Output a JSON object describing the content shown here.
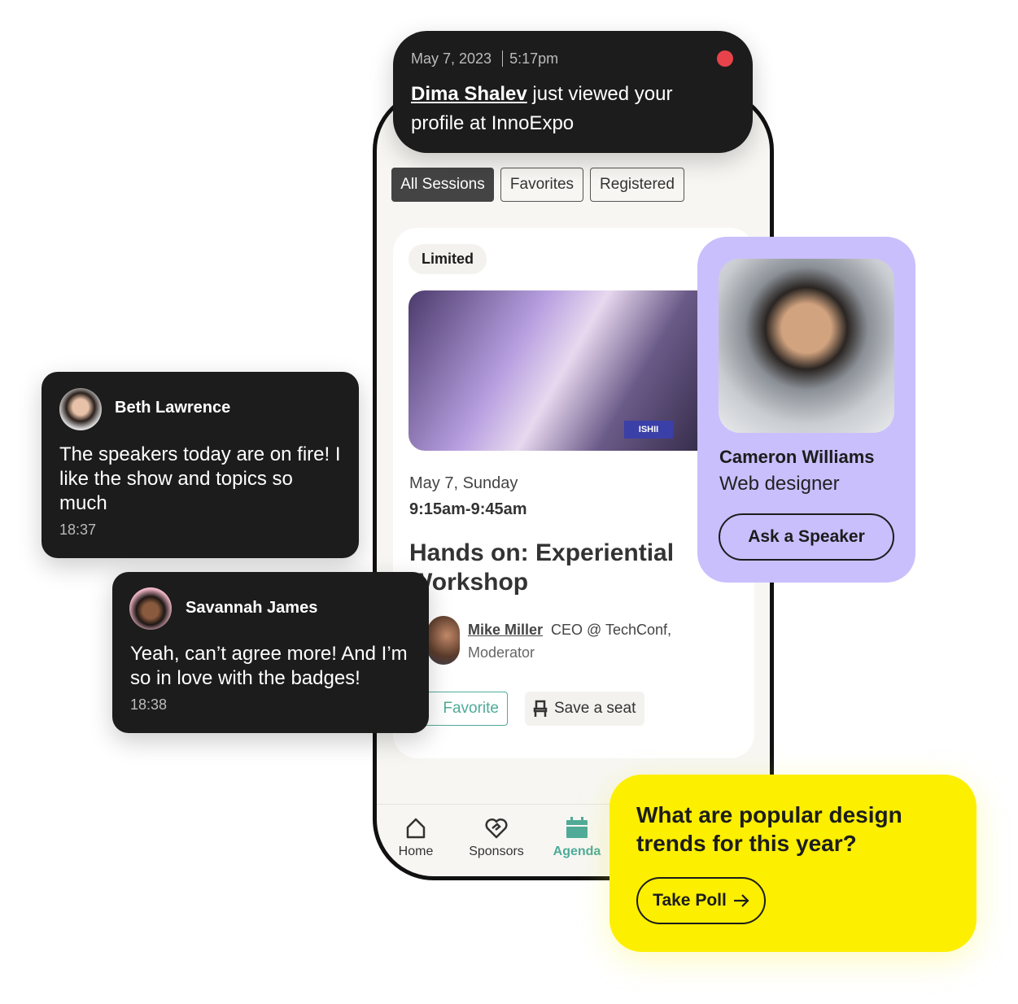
{
  "notification": {
    "date": "May 7, 2023",
    "time": "5:17pm",
    "name": "Dima Shalev",
    "message": " just viewed your profile at InnoExpo",
    "dot_color": "#e8434b"
  },
  "tabs": [
    {
      "label": "All Sessions",
      "active": true
    },
    {
      "label": "Favorites"
    },
    {
      "label": "Registered"
    }
  ],
  "session": {
    "badge": "Limited",
    "date": "May 7, Sunday",
    "time": "9:15am-9:45am",
    "title": "Hands on: Experiential Workshop",
    "image_sign": "ISHII",
    "speaker_name": "Mike Miller",
    "speaker_role": "CEO @ TechConf,",
    "speaker_tag": "Moderator",
    "favorite_label": "Favorite",
    "save_label": "Save a seat"
  },
  "nav": [
    {
      "label": "Home",
      "icon": "home-icon"
    },
    {
      "label": "Sponsors",
      "icon": "handshake-heart-icon"
    },
    {
      "label": "Agenda",
      "icon": "calendar-icon",
      "active": true
    }
  ],
  "speaker_card": {
    "name": "Cameron Williams",
    "role": "Web designer",
    "button": "Ask a Speaker",
    "bg": "#c9bffd"
  },
  "chats": [
    {
      "name": "Beth Lawrence",
      "text": "The speakers today are on fire! I like the show and topics so much",
      "time": "18:37"
    },
    {
      "name": "Savannah James",
      "text": "Yeah, can’t agree more! And I’m so in love with the badges!",
      "time": "18:38"
    }
  ],
  "poll": {
    "question": "What are popular design trends for this year?",
    "button": "Take Poll",
    "bg": "#fcef00"
  },
  "colors": {
    "accent": "#4fab98",
    "dark": "#1c1c1c"
  }
}
